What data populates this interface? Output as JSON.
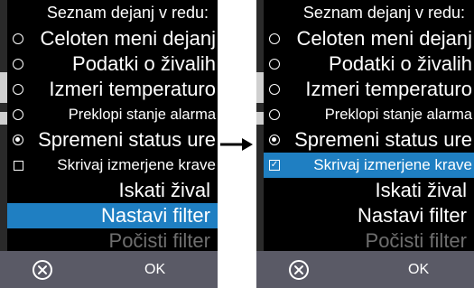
{
  "accent_color": "#1f7fc2",
  "left": {
    "title": "Seznam dejanj v redu:",
    "items": [
      {
        "label": "Celoten meni dejanj",
        "mark": "radio"
      },
      {
        "label": "Podatki o živalih",
        "mark": "radio"
      },
      {
        "label": "Izmeri temperaturo",
        "mark": "radio"
      },
      {
        "label": "Preklopi stanje alarma",
        "mark": "radio"
      },
      {
        "label": "Spremeni status ure",
        "mark": "radio-checked"
      },
      {
        "label": "Skrivaj izmerjene krave",
        "mark": "checkbox"
      },
      {
        "label": "Iskati žival",
        "mark": "none"
      },
      {
        "label": "Nastavi filter",
        "mark": "none",
        "selected": true
      },
      {
        "label": "Počisti filter",
        "mark": "none",
        "disabled": true
      }
    ],
    "ok_label": "OK",
    "cancel_icon": "cancel-circle-x-icon"
  },
  "right": {
    "title": "Seznam dejanj v redu:",
    "items": [
      {
        "label": "Celoten meni dejanj",
        "mark": "radio"
      },
      {
        "label": "Podatki o živalih",
        "mark": "radio"
      },
      {
        "label": "Izmeri temperaturo",
        "mark": "radio"
      },
      {
        "label": "Preklopi stanje alarma",
        "mark": "radio"
      },
      {
        "label": "Spremeni status ure",
        "mark": "radio-checked"
      },
      {
        "label": "Skrivaj izmerjene krave",
        "mark": "checkbox-checked",
        "selected": true
      },
      {
        "label": "Iskati žival",
        "mark": "none"
      },
      {
        "label": "Nastavi filter",
        "mark": "none"
      },
      {
        "label": "Počisti filter",
        "mark": "none",
        "disabled": true
      }
    ],
    "ok_label": "OK",
    "cancel_icon": "cancel-circle-x-icon"
  },
  "transition_icon": "arrow-right-icon"
}
